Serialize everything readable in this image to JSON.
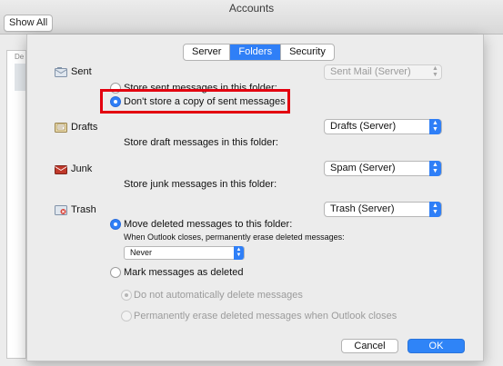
{
  "window": {
    "title": "Accounts",
    "show_all_label": "Show All"
  },
  "background": {
    "list_label": "De"
  },
  "tabs": [
    {
      "label": "Server",
      "active": false
    },
    {
      "label": "Folders",
      "active": true
    },
    {
      "label": "Security",
      "active": false
    }
  ],
  "sent": {
    "label": "Sent",
    "icon": "sent-folder-icon",
    "folder_popup": "Sent Mail (Server)",
    "option_store": "Store sent messages in this folder:",
    "option_dont_store": "Don't store a copy of sent messages",
    "selected": "dont_store"
  },
  "drafts": {
    "label": "Drafts",
    "icon": "drafts-folder-icon",
    "folder_popup": "Drafts (Server)",
    "description": "Store draft messages in this folder:"
  },
  "junk": {
    "label": "Junk",
    "icon": "junk-folder-icon",
    "folder_popup": "Spam (Server)",
    "description": "Store junk messages in this folder:"
  },
  "trash": {
    "label": "Trash",
    "icon": "trash-folder-icon",
    "folder_popup": "Trash (Server)",
    "option_move": "Move deleted messages to this folder:",
    "erase_note": "When Outlook closes, permanently erase deleted messages:",
    "erase_popup": "Never",
    "option_mark": "Mark messages as deleted",
    "sub_option_keep": "Do not automatically delete messages",
    "sub_option_erase": "Permanently erase deleted messages when Outlook closes",
    "selected": "move"
  },
  "buttons": {
    "cancel": "Cancel",
    "ok": "OK"
  },
  "colors": {
    "accent": "#2f7ff7",
    "highlight": "#e3000f"
  }
}
